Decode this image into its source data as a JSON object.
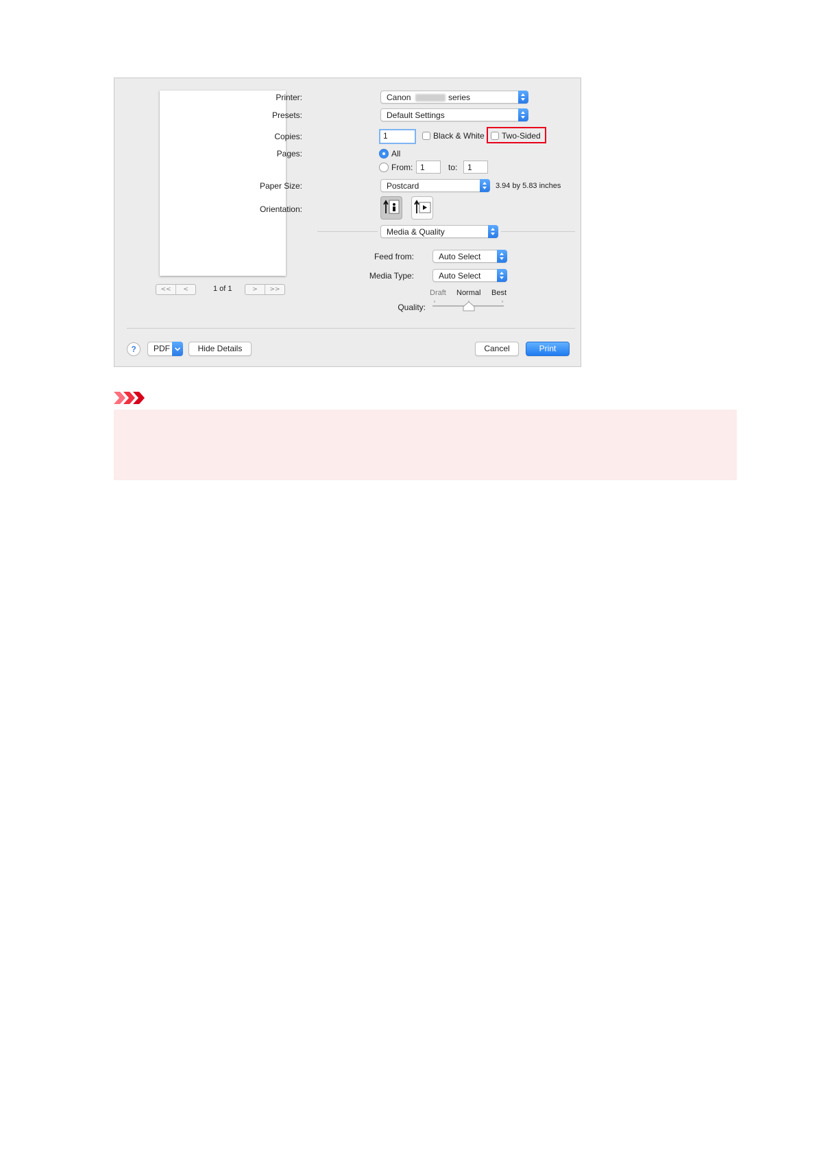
{
  "dialog": {
    "preview": {
      "page_indicator": "1 of 1",
      "first_label": "<<",
      "prev_label": "<",
      "next_label": ">",
      "last_label": ">>"
    },
    "printer": {
      "label": "Printer:",
      "name_prefix": "Canon",
      "name_suffix": "series"
    },
    "presets": {
      "label": "Presets:",
      "value": "Default Settings"
    },
    "copies": {
      "label": "Copies:",
      "value": "1"
    },
    "black_white": {
      "label": "Black & White",
      "checked": false
    },
    "two_sided": {
      "label": "Two-Sided",
      "checked": false
    },
    "pages": {
      "label": "Pages:",
      "all_label": "All",
      "from_label": "From:",
      "from_value": "1",
      "to_label": "to:",
      "to_value": "1"
    },
    "paper_size": {
      "label": "Paper Size:",
      "value": "Postcard",
      "dimensions": "3.94 by 5.83 inches"
    },
    "orientation": {
      "label": "Orientation:",
      "selected": "portrait"
    },
    "section_popup": {
      "value": "Media & Quality"
    },
    "feed_from": {
      "label": "Feed from:",
      "value": "Auto Select"
    },
    "media_type": {
      "label": "Media Type:",
      "value": "Auto Select"
    },
    "quality": {
      "label": "Quality:",
      "ticks": [
        "Draft",
        "Normal",
        "Best"
      ],
      "selected": "Normal"
    },
    "footer": {
      "help": "?",
      "pdf_label": "PDF",
      "hide_details_label": "Hide Details",
      "cancel_label": "Cancel",
      "print_label": "Print"
    }
  },
  "colors": {
    "highlight": "#e8001c",
    "note_background": "#fcecec",
    "accent_blue": "#2b7be6",
    "important_icon": "#e8001c"
  }
}
